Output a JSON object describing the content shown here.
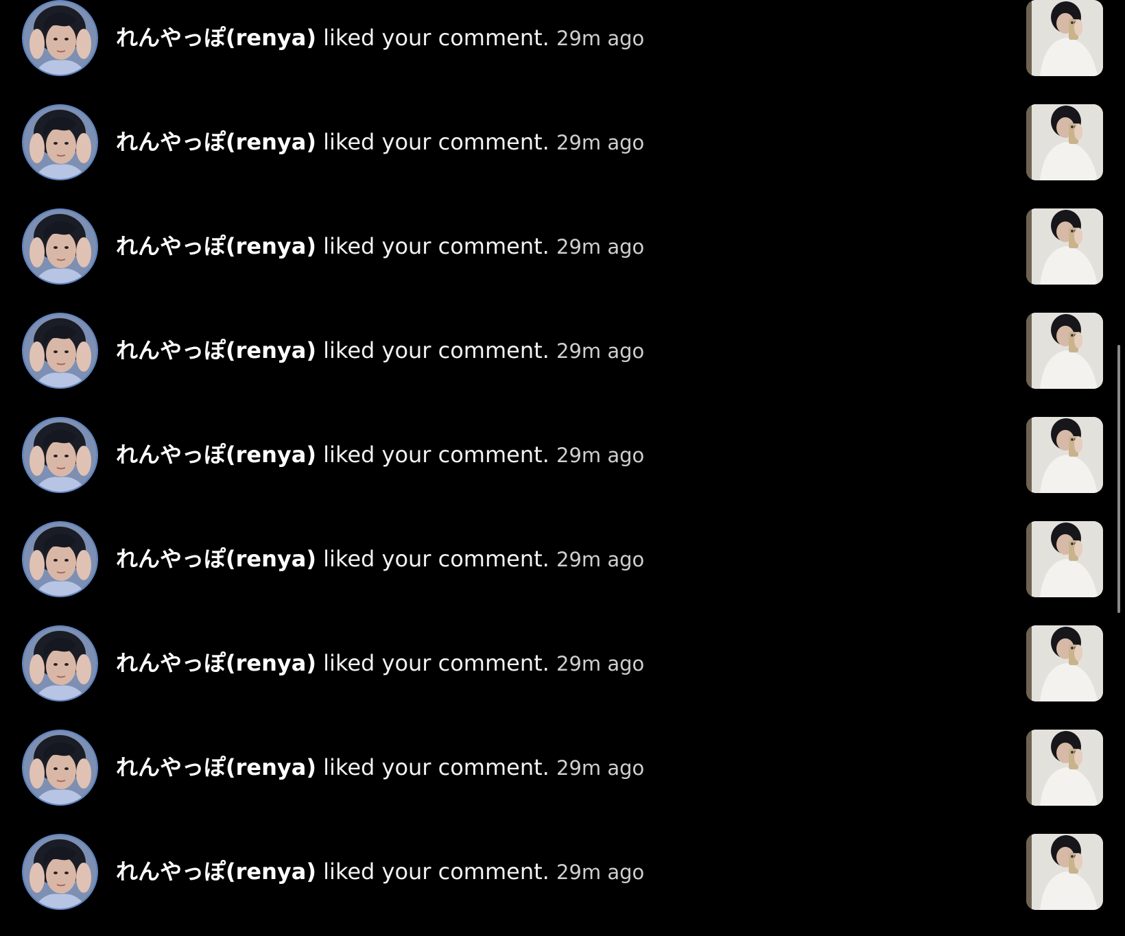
{
  "notifications": [
    {
      "username": "れんやっぽ(renya)",
      "action": " liked your comment.",
      "time": "29m ago",
      "avatar_icon": "user-avatar",
      "thumbnail_icon": "post-thumbnail"
    },
    {
      "username": "れんやっぽ(renya)",
      "action": " liked your comment.",
      "time": "29m ago",
      "avatar_icon": "user-avatar",
      "thumbnail_icon": "post-thumbnail"
    },
    {
      "username": "れんやっぽ(renya)",
      "action": " liked your comment.",
      "time": "29m ago",
      "avatar_icon": "user-avatar",
      "thumbnail_icon": "post-thumbnail"
    },
    {
      "username": "れんやっぽ(renya)",
      "action": " liked your comment.",
      "time": "29m ago",
      "avatar_icon": "user-avatar",
      "thumbnail_icon": "post-thumbnail"
    },
    {
      "username": "れんやっぽ(renya)",
      "action": " liked your comment.",
      "time": "29m ago",
      "avatar_icon": "user-avatar",
      "thumbnail_icon": "post-thumbnail"
    },
    {
      "username": "れんやっぽ(renya)",
      "action": " liked your comment.",
      "time": "29m ago",
      "avatar_icon": "user-avatar",
      "thumbnail_icon": "post-thumbnail"
    },
    {
      "username": "れんやっぽ(renya)",
      "action": " liked your comment.",
      "time": "29m ago",
      "avatar_icon": "user-avatar",
      "thumbnail_icon": "post-thumbnail"
    },
    {
      "username": "れんやっぽ(renya)",
      "action": " liked your comment.",
      "time": "29m ago",
      "avatar_icon": "user-avatar",
      "thumbnail_icon": "post-thumbnail"
    },
    {
      "username": "れんやっぽ(renya)",
      "action": " liked your comment.",
      "time": "29m ago",
      "avatar_icon": "user-avatar",
      "thumbnail_icon": "post-thumbnail"
    }
  ],
  "colors": {
    "background": "#000000",
    "text": "#f2f2f2",
    "time_text": "#cfcfcf",
    "avatar_ring": "#5f86c5",
    "scrollbar": "#8a8a8a"
  }
}
